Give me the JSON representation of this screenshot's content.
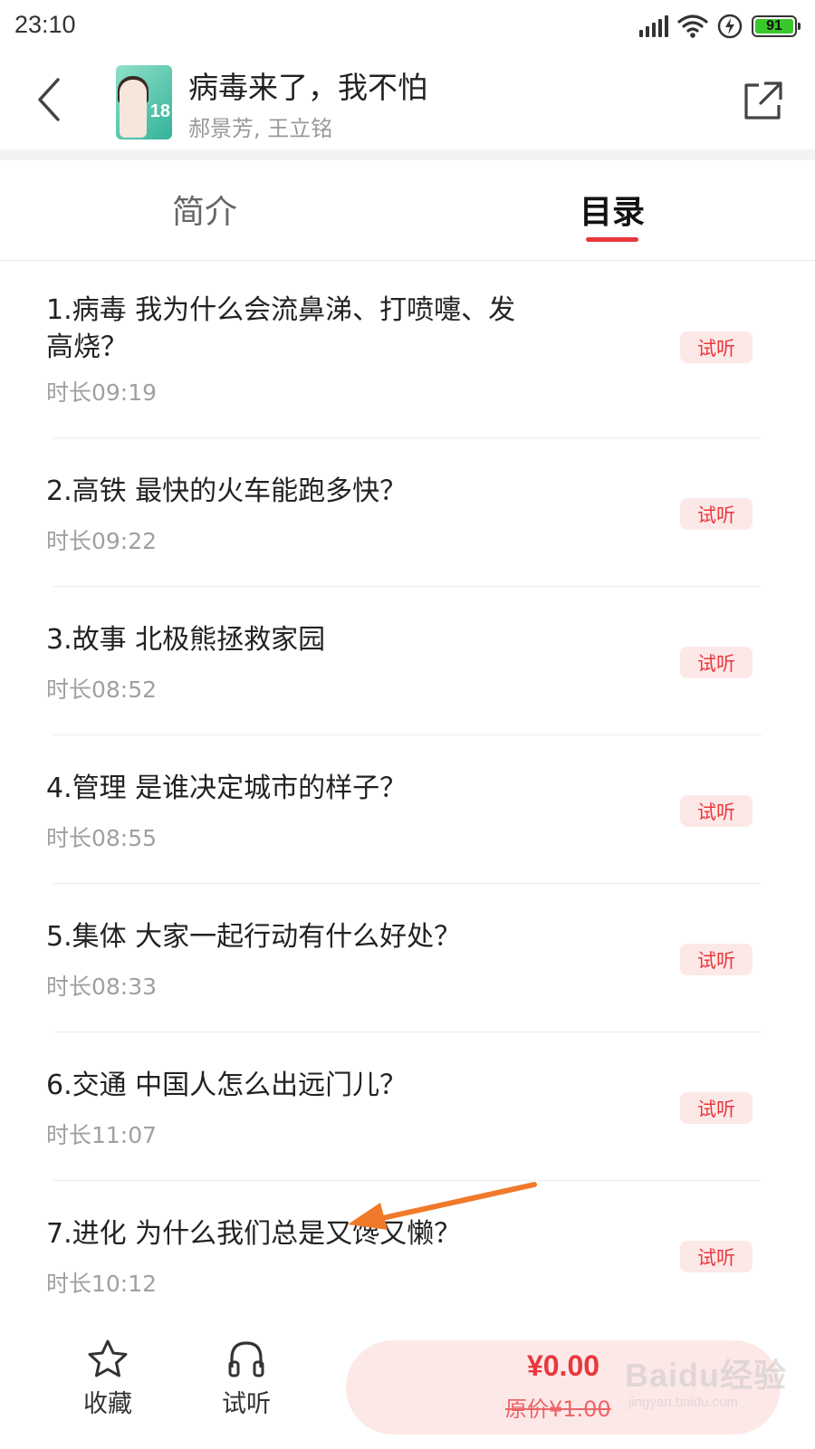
{
  "status_bar": {
    "time": "23:10",
    "battery": "91"
  },
  "header": {
    "title": "病毒来了，我不怕",
    "authors": "郝景芳, 王立铭",
    "cover_badge": "18"
  },
  "tabs": [
    {
      "label": "简介",
      "active": false
    },
    {
      "label": "目录",
      "active": true
    }
  ],
  "catalog": [
    {
      "title": "1.病毒  我为什么会流鼻涕、打喷嚏、发高烧？",
      "duration": "时长09:19",
      "badge": "试听"
    },
    {
      "title": "2.高铁  最快的火车能跑多快？",
      "duration": "时长09:22",
      "badge": "试听"
    },
    {
      "title": "3.故事  北极熊拯救家园",
      "duration": "时长08:52",
      "badge": "试听"
    },
    {
      "title": "4.管理  是谁决定城市的样子？",
      "duration": "时长08:55",
      "badge": "试听"
    },
    {
      "title": "5.集体  大家一起行动有什么好处？",
      "duration": "时长08:33",
      "badge": "试听"
    },
    {
      "title": "6.交通  中国人怎么出远门儿？",
      "duration": "时长11:07",
      "badge": "试听"
    },
    {
      "title": "7.进化  为什么我们总是又馋又懒？",
      "duration": "时长10:12",
      "badge": "试听"
    }
  ],
  "bottom_bar": {
    "favorite_label": "收藏",
    "listen_label": "试听",
    "price": "¥0.00",
    "original_price": "原价¥1.00"
  },
  "watermark": {
    "main": "Baidu经验",
    "sub": "jingyan.baidu.com"
  },
  "colors": {
    "accent": "#e8383d",
    "badge_bg": "#fde8e8",
    "arrow": "#f07a2a"
  }
}
